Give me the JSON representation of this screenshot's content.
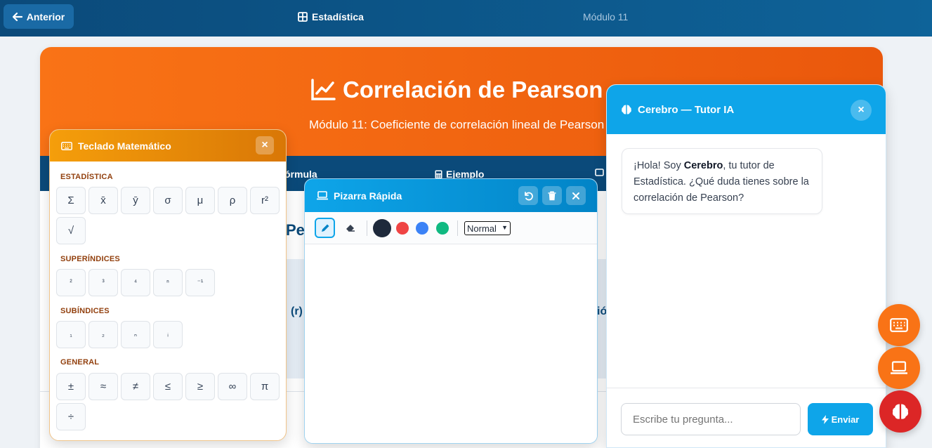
{
  "nav": {
    "back_label": "Anterior",
    "title": "Estadística",
    "module": "Módulo 11"
  },
  "hero": {
    "title": "Correlación de Pearson",
    "subtitle": "Módulo 11: Coeficiente de correlación lineal de Pearson ("
  },
  "tabs": [
    {
      "label": "órmula",
      "icon": "formula-icon"
    },
    {
      "label": "Ejemplo",
      "icon": "calculator-icon"
    }
  ],
  "content": {
    "heading_fragment": "Pe",
    "fragment_r": "(r)",
    "fragment_io": "ió"
  },
  "keyboard": {
    "title": "Teclado Matemático",
    "close": "×",
    "sections": [
      {
        "label": "ESTADÍSTICA",
        "keys": [
          "Σ",
          "x̄",
          "ȳ",
          "σ",
          "μ",
          "ρ",
          "r²",
          "√"
        ]
      },
      {
        "label": "SUPERÍNDICES",
        "keys": [
          "²",
          "³",
          "⁴",
          "ⁿ",
          "⁻¹"
        ]
      },
      {
        "label": "SUBÍNDICES",
        "keys": [
          "₁",
          "₂",
          "ₙ",
          "ᵢ"
        ]
      },
      {
        "label": "GENERAL",
        "keys": [
          "±",
          "≈",
          "≠",
          "≤",
          "≥",
          "∞",
          "π",
          "÷"
        ]
      }
    ]
  },
  "whiteboard": {
    "title": "Pizarra Rápida",
    "colors": [
      "#1e293b",
      "#ef4444",
      "#3b82f6",
      "#10b981"
    ],
    "size_selected": "Normal"
  },
  "tutor": {
    "title": "Cerebro — Tutor IA",
    "close": "×",
    "greeting_pre": "¡Hola! Soy ",
    "greeting_name": "Cerebro",
    "greeting_post": ", tu tutor de Estadística. ¿Qué duda tienes sobre la correlación de Pearson?",
    "input_placeholder": "Escribe tu pregunta...",
    "send_label": "Enviar"
  },
  "fabs": [
    {
      "name": "keyboard-fab",
      "icon": "keyboard-icon",
      "color": "#f97316"
    },
    {
      "name": "whiteboard-fab",
      "icon": "laptop-icon",
      "color": "#f97316"
    },
    {
      "name": "tutor-fab",
      "icon": "brain-icon",
      "color": "#dc2626"
    }
  ]
}
